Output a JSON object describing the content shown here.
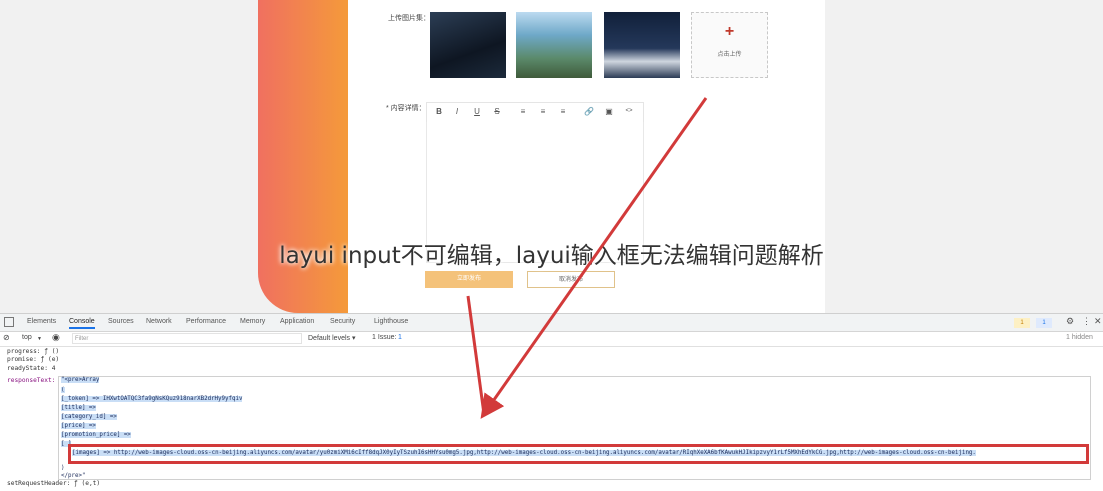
{
  "form": {
    "upload_label": "上传图片集：",
    "upload_button_text": "点击上传",
    "upload_plus": "+",
    "detail_label": "* 内容详情：",
    "toolbar_icons": [
      "B",
      "I",
      "U",
      "S",
      "≡",
      "≡",
      "≡",
      "🔗",
      "▣",
      "<>"
    ],
    "submit_label": "立即发布",
    "cancel_label": "取消发布"
  },
  "overlay": {
    "title": "layui input不可编辑，layui输入框无法编辑问题解析"
  },
  "devtools": {
    "tabs": [
      "Elements",
      "Console",
      "Sources",
      "Network",
      "Performance",
      "Memory",
      "Application",
      "Security",
      "Lighthouse"
    ],
    "active_tab": "Console",
    "warn_count": "1",
    "info_count": "1",
    "context": "top",
    "filter_placeholder": "Filter",
    "default_levels": "Default levels ▾",
    "issue_text": "1 Issue:",
    "issue_count": "1",
    "hidden_text": "1 hidden",
    "log": {
      "progress": "progress: ƒ ()",
      "promise": "promise: ƒ (e)",
      "ready_state": "readyState: 4",
      "response_text_key": "responseText:",
      "response_text_start": "\"<pre>Array",
      "set_request_header": "setRequestHeader: ƒ (e,t)"
    },
    "response_lines": [
      "(",
      "    [_token] => IHXwtOATQC3fa9gNsKQuz918narXB2drHy9yfqiv",
      "    [title] =>",
      "    [category_id] =>",
      "    [price] =>",
      "    [promotion_price] =>",
      "    [                    ]"
    ],
    "images_line": "    [images] => http://web-images-cloud.oss-cn-beijing.aliyuncs.com/avatar/yu0zmiXMi6cIff8dqJX0yIyTSzuhI6sHHYsu0mg5.jpg,http://web-images-cloud.oss-cn-beijing.aliyuncs.com/avatar/RIqhXeXA6bfKAwukHJIkipzvyY1rLf5MXhEdYkCG.jpg,http://web-images-cloud.oss-cn-beijing.",
    "close_paren": ")",
    "pre_close": "</pre>\""
  },
  "colors": {
    "accent_red": "#d23a3a",
    "gradient_start": "#f07060",
    "gradient_end": "#f49a3a",
    "submit_bg": "#f4c27a"
  }
}
